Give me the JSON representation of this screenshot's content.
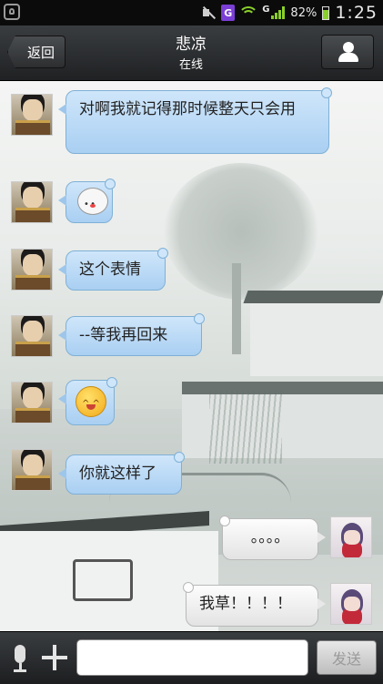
{
  "status_bar": {
    "battery": "82%",
    "time": "1:25",
    "network": "G"
  },
  "header": {
    "back_label": "返回",
    "contact_name": "悲凉",
    "contact_status": "在线"
  },
  "messages": [
    {
      "side": "in",
      "type": "text",
      "text": "对啊我就记得那时候整天只会用"
    },
    {
      "side": "in",
      "type": "emoji",
      "icon": "cloud-face-icon"
    },
    {
      "side": "in",
      "type": "text",
      "text": "这个表情"
    },
    {
      "side": "in",
      "type": "text",
      "text": "--等我再回来"
    },
    {
      "side": "in",
      "type": "emoji",
      "icon": "smiley-face-icon"
    },
    {
      "side": "in",
      "type": "text",
      "text": "你就这样了"
    },
    {
      "side": "out",
      "type": "text",
      "text": "。。。。"
    },
    {
      "side": "out",
      "type": "text",
      "text": "我草！！！！"
    }
  ],
  "input_bar": {
    "message_value": "",
    "send_label": "发送"
  },
  "colors": {
    "incoming_bubble": "#a9cff2",
    "outgoing_bubble": "#e3e3e3",
    "header_bg": "#2c2e30"
  }
}
